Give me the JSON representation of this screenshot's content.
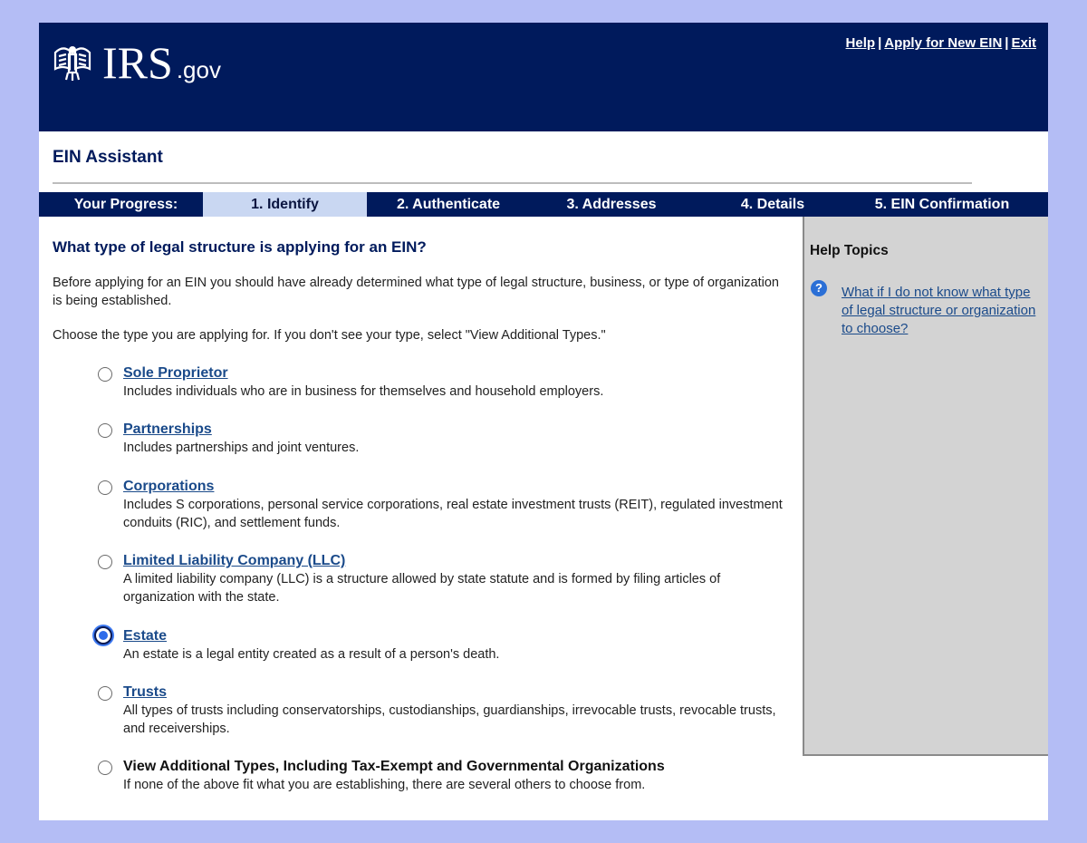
{
  "header": {
    "logo_text": "IRS",
    "logo_suffix": ".gov",
    "links": {
      "help": "Help",
      "apply": "Apply for New EIN",
      "exit": "Exit",
      "separator": "|"
    }
  },
  "section_title": "EIN Assistant",
  "progress": {
    "label": "Your Progress:",
    "steps": [
      "1. Identify",
      "2. Authenticate",
      "3. Addresses",
      "4. Details",
      "5. EIN Confirmation"
    ],
    "active_step": "1. Identify"
  },
  "main": {
    "question": "What type of legal structure is applying for an EIN?",
    "intro": "Before applying for an EIN you should have already determined what type of legal structure, business, or type of organization is being established.",
    "choose": "Choose the type you are applying for. If you don't see your type, select \"View Additional Types.\"",
    "options": [
      {
        "title": "Sole Proprietor",
        "desc": "Includes individuals who are in business for themselves and household employers.",
        "selected": false
      },
      {
        "title": "Partnerships",
        "desc": "Includes partnerships and joint ventures.",
        "selected": false
      },
      {
        "title": "Corporations",
        "desc": "Includes S corporations, personal service corporations, real estate investment trusts (REIT), regulated investment conduits (RIC), and settlement funds.",
        "selected": false
      },
      {
        "title": "Limited Liability Company (LLC)",
        "desc": "A limited liability company (LLC) is a structure allowed by state statute and is formed by filing articles of organization with the state.",
        "selected": false
      },
      {
        "title": "Estate",
        "desc": "An estate is a legal entity created as a result of a person's death.",
        "selected": true
      },
      {
        "title": "Trusts",
        "desc": "All types of trusts including conservatorships, custodianships, guardianships, irrevocable trusts, revocable trusts, and receiverships.",
        "selected": false
      },
      {
        "title": "View Additional Types, Including Tax-Exempt and Governmental Organizations",
        "desc": "If none of the above fit what you are establishing, there are several others to choose from.",
        "selected": false
      }
    ]
  },
  "help_panel": {
    "title": "Help Topics",
    "icon": "question-circle-icon",
    "link": "What if I do not know what type of legal structure or organization to choose?"
  },
  "colors": {
    "navy": "#001a5c",
    "active_step": "#c9d7f2",
    "link": "#1a4a8a",
    "page_bg": "#b4bdf5",
    "help_bg": "#d3d3d3"
  }
}
